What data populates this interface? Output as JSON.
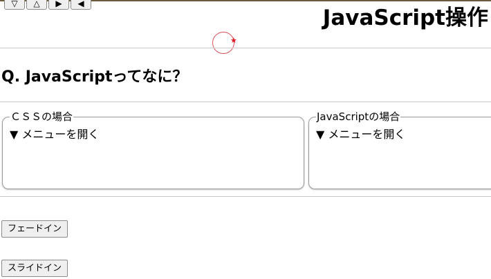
{
  "nav_buttons": [
    {
      "icon": "triangle-down-outline-icon",
      "glyph": "▽"
    },
    {
      "icon": "triangle-up-outline-icon",
      "glyph": "△"
    },
    {
      "icon": "play-icon",
      "glyph": "▶"
    },
    {
      "icon": "back-icon",
      "glyph": "◀"
    }
  ],
  "header": {
    "title": "JavaScript操作"
  },
  "question": "Q. JavaScriptってなに？",
  "panels": [
    {
      "legend": "ＣＳＳの場合",
      "menu_label": "▼ メニューを開く"
    },
    {
      "legend": "JavaScriptの場合",
      "menu_label": "▼ メニューを開く"
    }
  ],
  "buttons": {
    "fade_in": "フェードイン",
    "slide_in": "スライドイン"
  },
  "colors": {
    "cursor_ring": "#e0505a",
    "cursor_star": "#e01020",
    "top_border": "#6b5a3a"
  }
}
